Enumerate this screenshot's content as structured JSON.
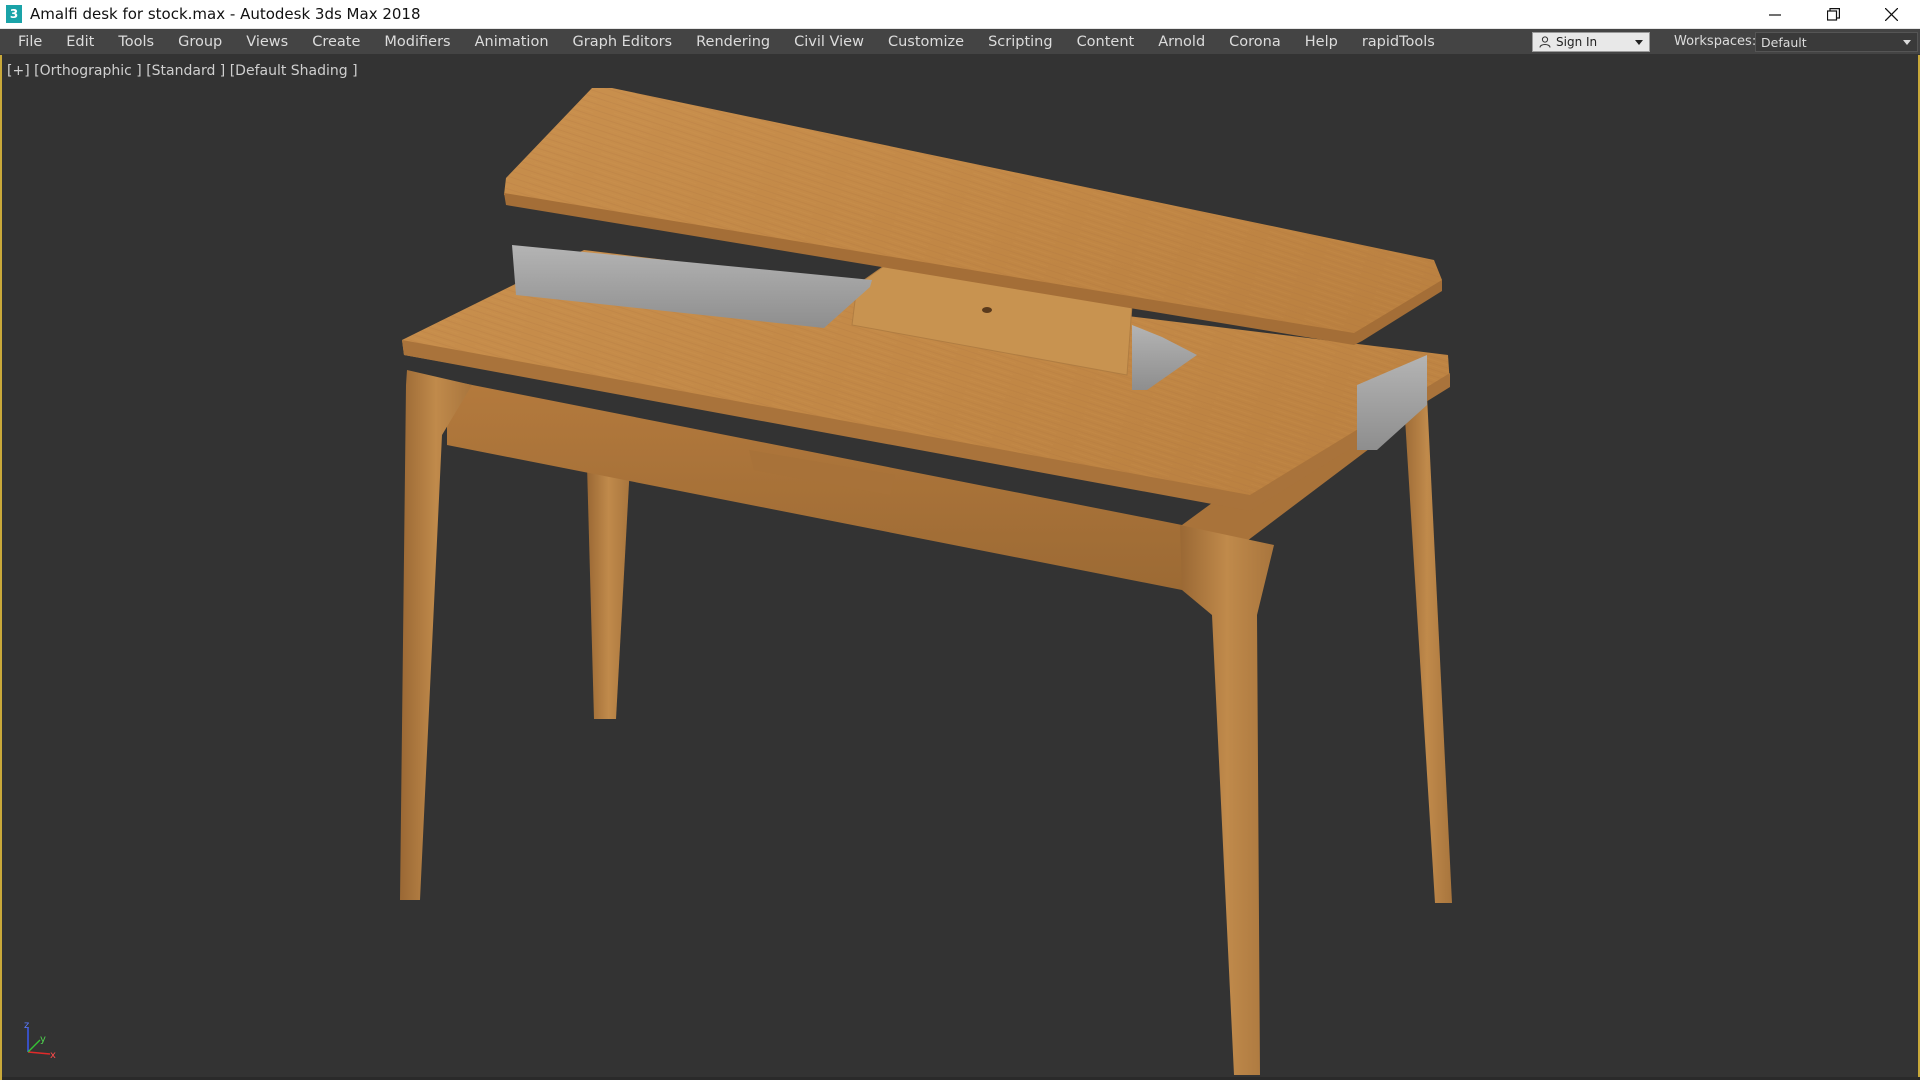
{
  "window": {
    "app_icon_glyph": "3",
    "title": "Amalfi desk for stock.max - Autodesk 3ds Max 2018",
    "controls": [
      "minimize-icon",
      "restore-icon",
      "close-icon"
    ]
  },
  "menu": {
    "items": [
      "File",
      "Edit",
      "Tools",
      "Group",
      "Views",
      "Create",
      "Modifiers",
      "Animation",
      "Graph Editors",
      "Rendering",
      "Civil View",
      "Customize",
      "Scripting",
      "Content",
      "Arnold",
      "Corona",
      "Help",
      "rapidTools"
    ]
  },
  "account": {
    "signin_label": "Sign In",
    "icon": "user-icon"
  },
  "workspace": {
    "label": "Workspaces:",
    "selected": "Default"
  },
  "viewport": {
    "label": "[+] [Orthographic ] [Standard ] [Default Shading ]",
    "axis": {
      "z": "z",
      "y": "y",
      "x": "x"
    }
  },
  "colors": {
    "viewport_bg": "#333333",
    "menubar_bg": "#444444",
    "active_border": "#c9a93a",
    "wood": "#c48a45",
    "metal": "#a6a6a6"
  }
}
